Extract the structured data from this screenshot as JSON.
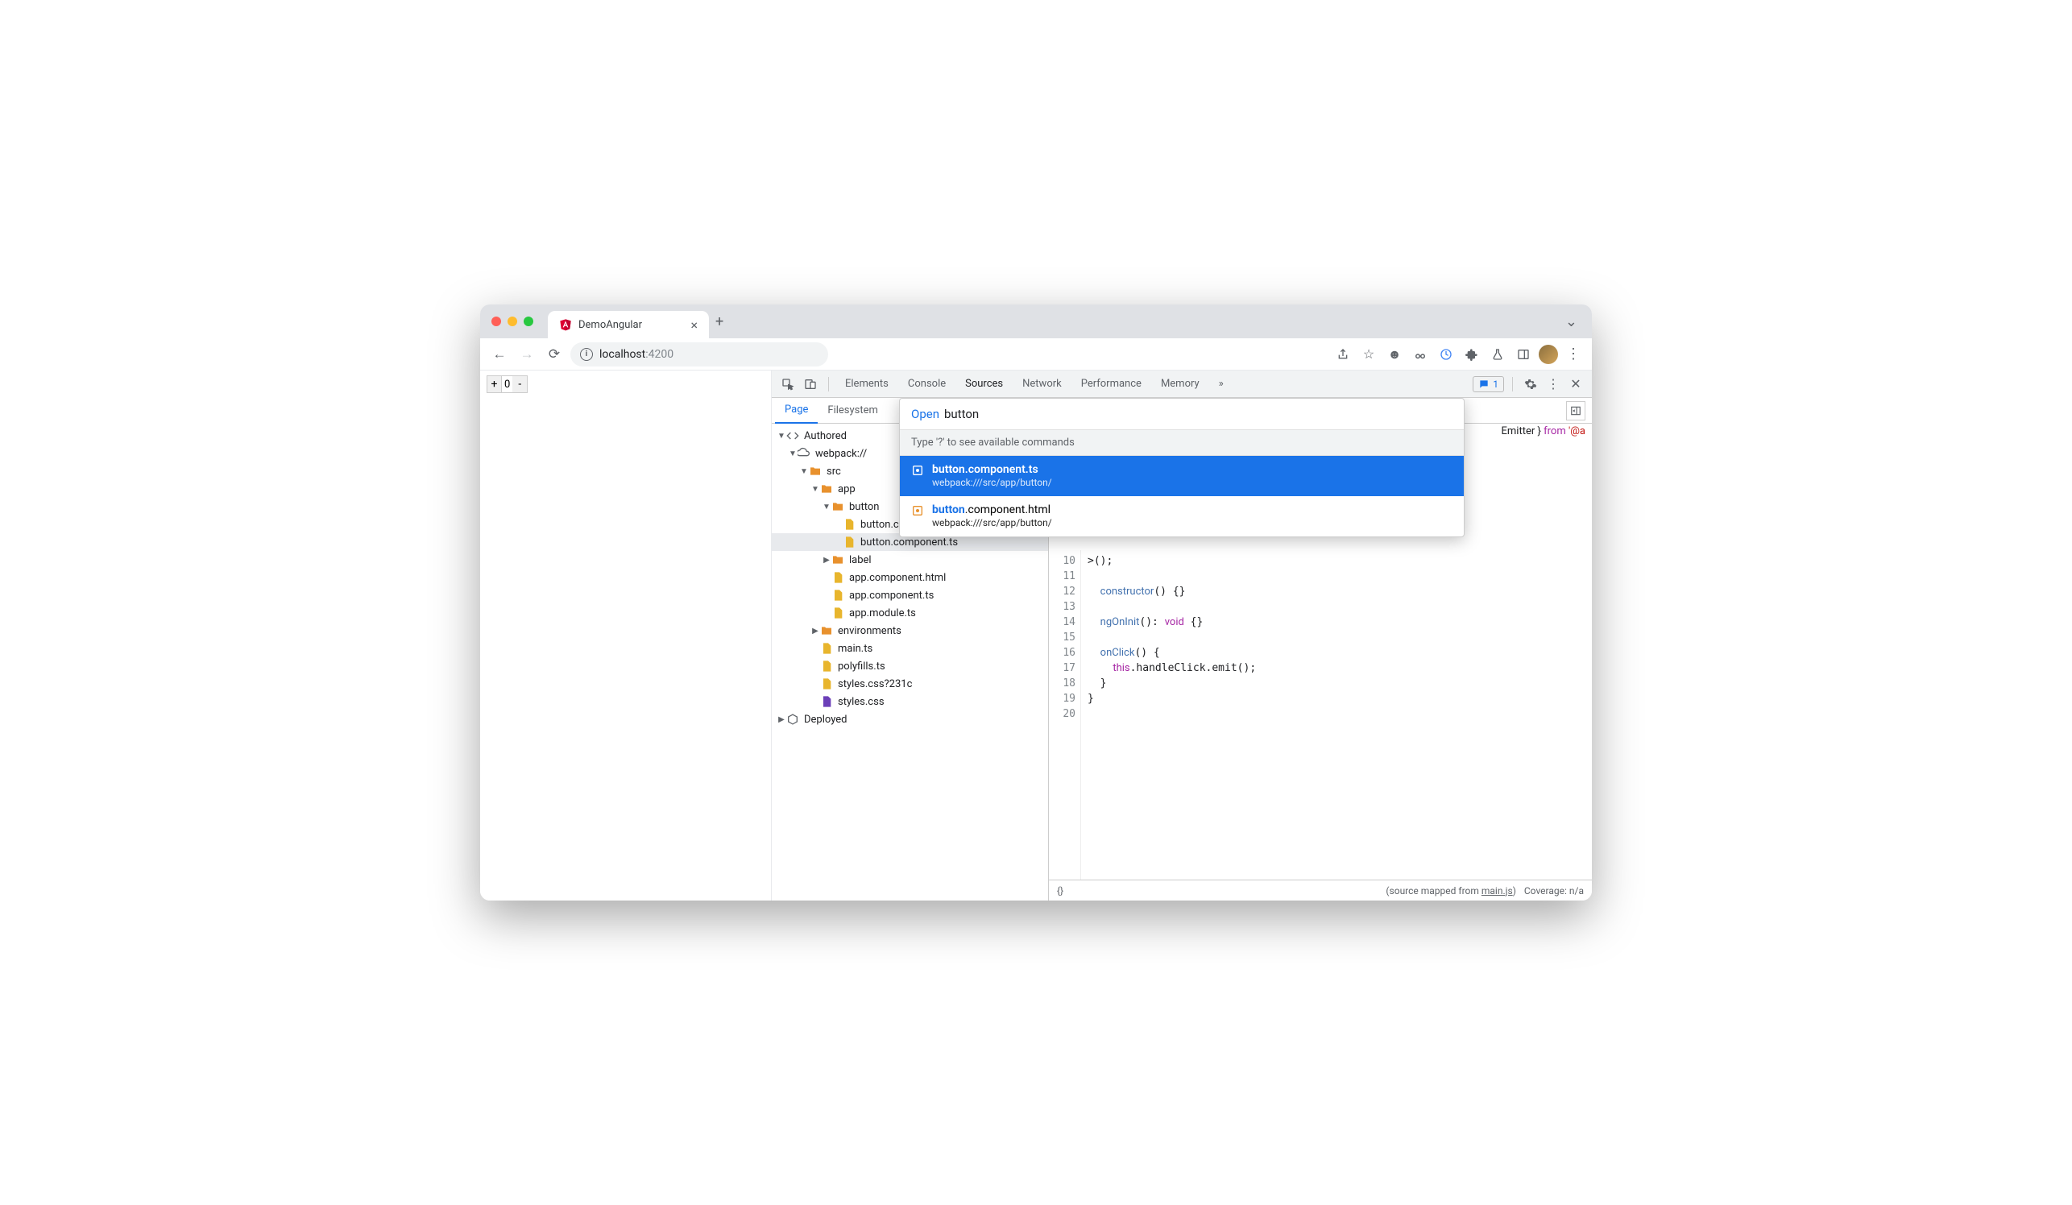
{
  "browser": {
    "tab_title": "DemoAngular",
    "url_host": "localhost",
    "url_port": ":4200"
  },
  "page_controls": {
    "plus": "+",
    "value": "0",
    "minus": "-"
  },
  "devtools": {
    "tabs": [
      "Elements",
      "Console",
      "Sources",
      "Network",
      "Performance",
      "Memory"
    ],
    "active_tab": "Sources",
    "overflow": "»",
    "issues_count": "1"
  },
  "sources": {
    "panel_tabs": [
      "Page",
      "Filesystem"
    ],
    "active": "Page",
    "tree": {
      "authored": "Authored",
      "webpack": "webpack://",
      "src": "src",
      "app": "app",
      "button_folder": "button",
      "button_html": "button.component.html",
      "button_ts": "button.component.ts",
      "label_folder": "label",
      "app_html": "app.component.html",
      "app_ts": "app.component.ts",
      "app_module": "app.module.ts",
      "environments": "environments",
      "main_ts": "main.ts",
      "polyfills": "polyfills.ts",
      "styles_q": "styles.css?231c",
      "styles": "styles.css",
      "deployed": "Deployed"
    }
  },
  "open_dialog": {
    "label": "Open",
    "query": "button",
    "hint": "Type '?' to see available commands",
    "results": [
      {
        "match": "button",
        "rest": ".component.ts",
        "path": "webpack:///src/app/button/"
      },
      {
        "match": "button",
        "rest": ".component.html",
        "path": "webpack:///src/app/button/"
      }
    ]
  },
  "code": {
    "visible_snippet_top": "Emitter } from '@a",
    "line_range_start": 10,
    "line_range_end": 20,
    "lines": {
      "l10": ">();",
      "l11": "",
      "l12": "  constructor() {}",
      "l13": "",
      "l14": "  ngOnInit(): void {}",
      "l15": "",
      "l16": "  onClick() {",
      "l17": "    this.handleClick.emit();",
      "l18": "  }",
      "l19": "}",
      "l20": ""
    }
  },
  "status": {
    "braces": "{}",
    "mapped_prefix": "(source mapped from ",
    "mapped_file": "main.js",
    "mapped_suffix": ")",
    "coverage": "Coverage: n/a"
  }
}
